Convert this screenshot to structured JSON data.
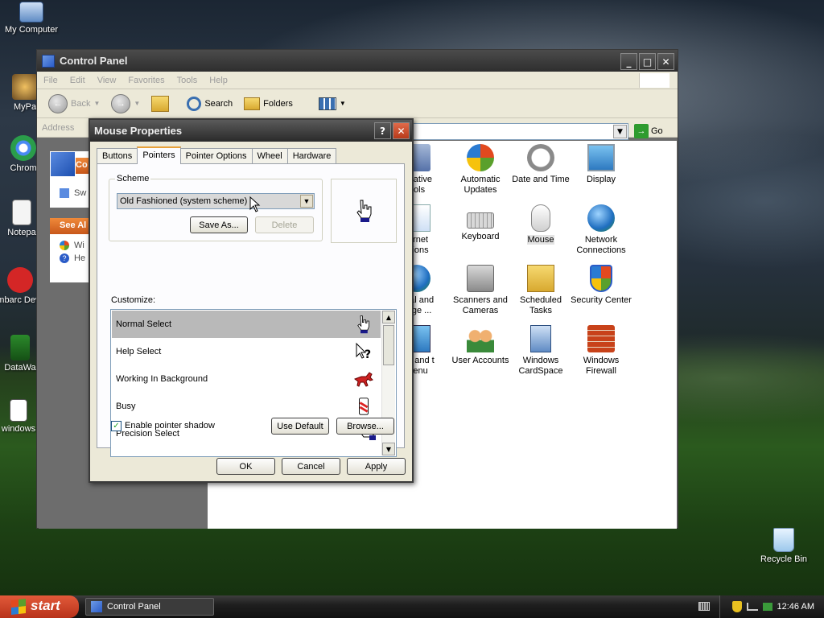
{
  "desktop": {
    "icons": [
      {
        "label": "My Computer"
      },
      {
        "label": "MyPa"
      },
      {
        "label": "Chrom"
      },
      {
        "label": "Notepa"
      },
      {
        "label": "Embarc Dev-C"
      },
      {
        "label": "DataWa"
      },
      {
        "label": "windows"
      },
      {
        "label": "Recycle Bin"
      }
    ]
  },
  "control_panel": {
    "title": "Control Panel",
    "menu": [
      "File",
      "Edit",
      "View",
      "Favorites",
      "Tools",
      "Help"
    ],
    "toolbar": {
      "back": "Back",
      "search": "Search",
      "folders": "Folders"
    },
    "address_label": "Address",
    "go_label": "Go",
    "left_pane": {
      "task_header": "Co",
      "switch_link": "Sw",
      "see_also_header": "See Al",
      "see_also_items": [
        "Wi",
        "He"
      ]
    },
    "items": [
      {
        "label": "istrative ools",
        "icon": "admin-tools-icon"
      },
      {
        "label": "Automatic Updates",
        "icon": "automatic-updates-icon"
      },
      {
        "label": "Date and Time",
        "icon": "date-time-icon"
      },
      {
        "label": "Display",
        "icon": "display-icon"
      },
      {
        "label": "ternet ptions",
        "icon": "internet-options-icon"
      },
      {
        "label": "Keyboard",
        "icon": "keyboard-icon"
      },
      {
        "label": "Mouse",
        "icon": "mouse-icon"
      },
      {
        "label": "Network Connections",
        "icon": "network-icon"
      },
      {
        "label": "onal and uage ...",
        "icon": "regional-icon"
      },
      {
        "label": "Scanners and Cameras",
        "icon": "scanner-icon"
      },
      {
        "label": "Scheduled Tasks",
        "icon": "scheduled-tasks-icon"
      },
      {
        "label": "Security Center",
        "icon": "security-center-icon"
      },
      {
        "label": "bar and t Menu",
        "icon": "taskbar-icon"
      },
      {
        "label": "User Accounts",
        "icon": "user-accounts-icon"
      },
      {
        "label": "Windows CardSpace",
        "icon": "cardspace-icon"
      },
      {
        "label": "Windows Firewall",
        "icon": "firewall-icon"
      }
    ]
  },
  "mouse_dialog": {
    "title": "Mouse Properties",
    "tabs": [
      "Buttons",
      "Pointers",
      "Pointer Options",
      "Wheel",
      "Hardware"
    ],
    "active_tab": "Pointers",
    "scheme_label": "Scheme",
    "scheme_value": "Old Fashioned (system scheme)",
    "save_as": "Save As...",
    "delete": "Delete",
    "customize_label": "Customize:",
    "pointers": [
      {
        "name": "Normal Select",
        "selected": true
      },
      {
        "name": "Help Select",
        "selected": false
      },
      {
        "name": "Working In Background",
        "selected": false
      },
      {
        "name": "Busy",
        "selected": false
      },
      {
        "name": "Precision Select",
        "selected": false
      }
    ],
    "enable_shadow_label": "Enable pointer shadow",
    "enable_shadow_checked": true,
    "use_default": "Use Default",
    "browse": "Browse...",
    "ok": "OK",
    "cancel": "Cancel",
    "apply": "Apply"
  },
  "taskbar": {
    "start": "start",
    "task": "Control Panel",
    "clock": "12:46 AM"
  }
}
